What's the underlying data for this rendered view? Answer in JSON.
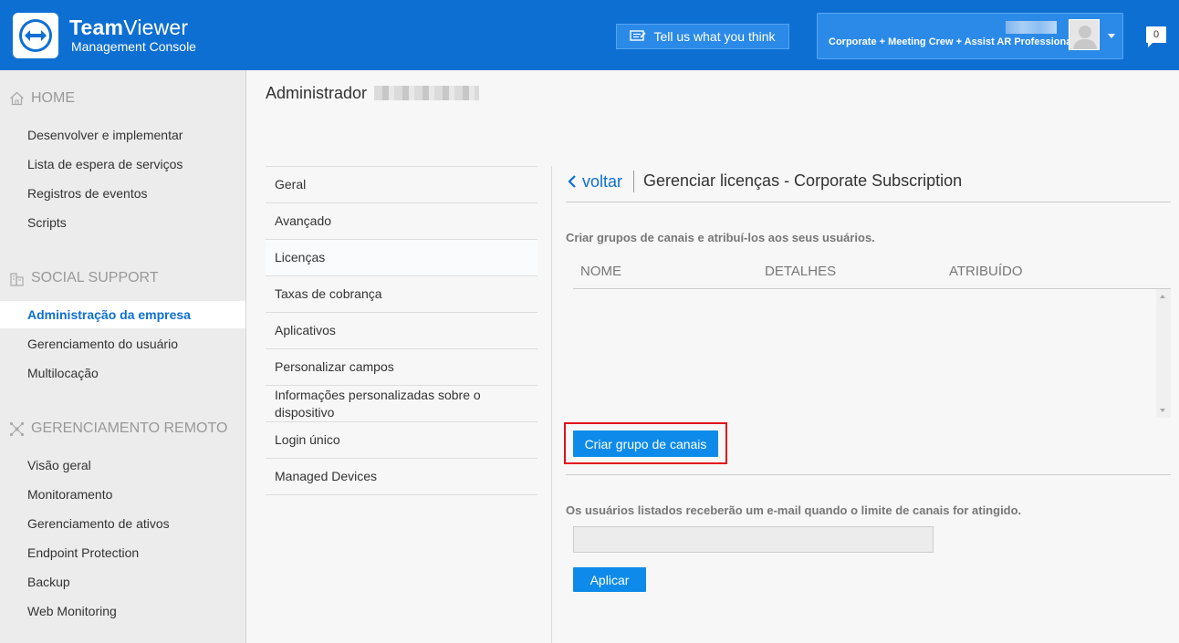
{
  "header": {
    "brand_bold": "Team",
    "brand_rest": "Viewer",
    "brand_sub": "Management Console",
    "feedback_label": "Tell us what you think",
    "plan": "Corporate + Meeting Crew + Assist AR Professional",
    "notifications": "0",
    "brand_color": "#0e6fd3"
  },
  "sidebar": {
    "sections": [
      {
        "title": "HOME",
        "icon": "home-icon",
        "items": [
          "Desenvolver e implementar",
          "Lista de espera de serviços",
          "Registros de eventos",
          "Scripts"
        ]
      },
      {
        "title": "SOCIAL SUPPORT",
        "icon": "building-icon",
        "items": [
          "Administração da empresa",
          "Gerenciamento do usuário",
          "Multilocação"
        ]
      },
      {
        "title": "GERENCIAMENTO REMOTO",
        "icon": "network-icon",
        "items": [
          "Visão geral",
          "Monitoramento",
          "Gerenciamento de ativos",
          "Endpoint Protection",
          "Backup",
          "Web Monitoring"
        ]
      }
    ],
    "active": "Administração da empresa"
  },
  "main": {
    "title": "Administrador",
    "subnav": [
      "Geral",
      "Avançado",
      "Licenças",
      "Taxas de cobrança",
      "Aplicativos",
      "Personalizar campos",
      "Informações personalizadas sobre o dispositivo",
      "Login único",
      "Managed Devices"
    ],
    "subnav_active": "Licenças"
  },
  "panel": {
    "back_label": "voltar",
    "title": "Gerenciar licenças - Corporate Subscription",
    "description": "Criar grupos de canais e atribuí-los aos seus usuários.",
    "columns": [
      "NOME",
      "DETALHES",
      "ATRIBUÍDO"
    ],
    "create_button": "Criar grupo de canais",
    "notice": "Os usuários listados receberão um e-mail quando o limite de canais for atingido.",
    "email_value": "",
    "apply_button": "Aplicar"
  }
}
